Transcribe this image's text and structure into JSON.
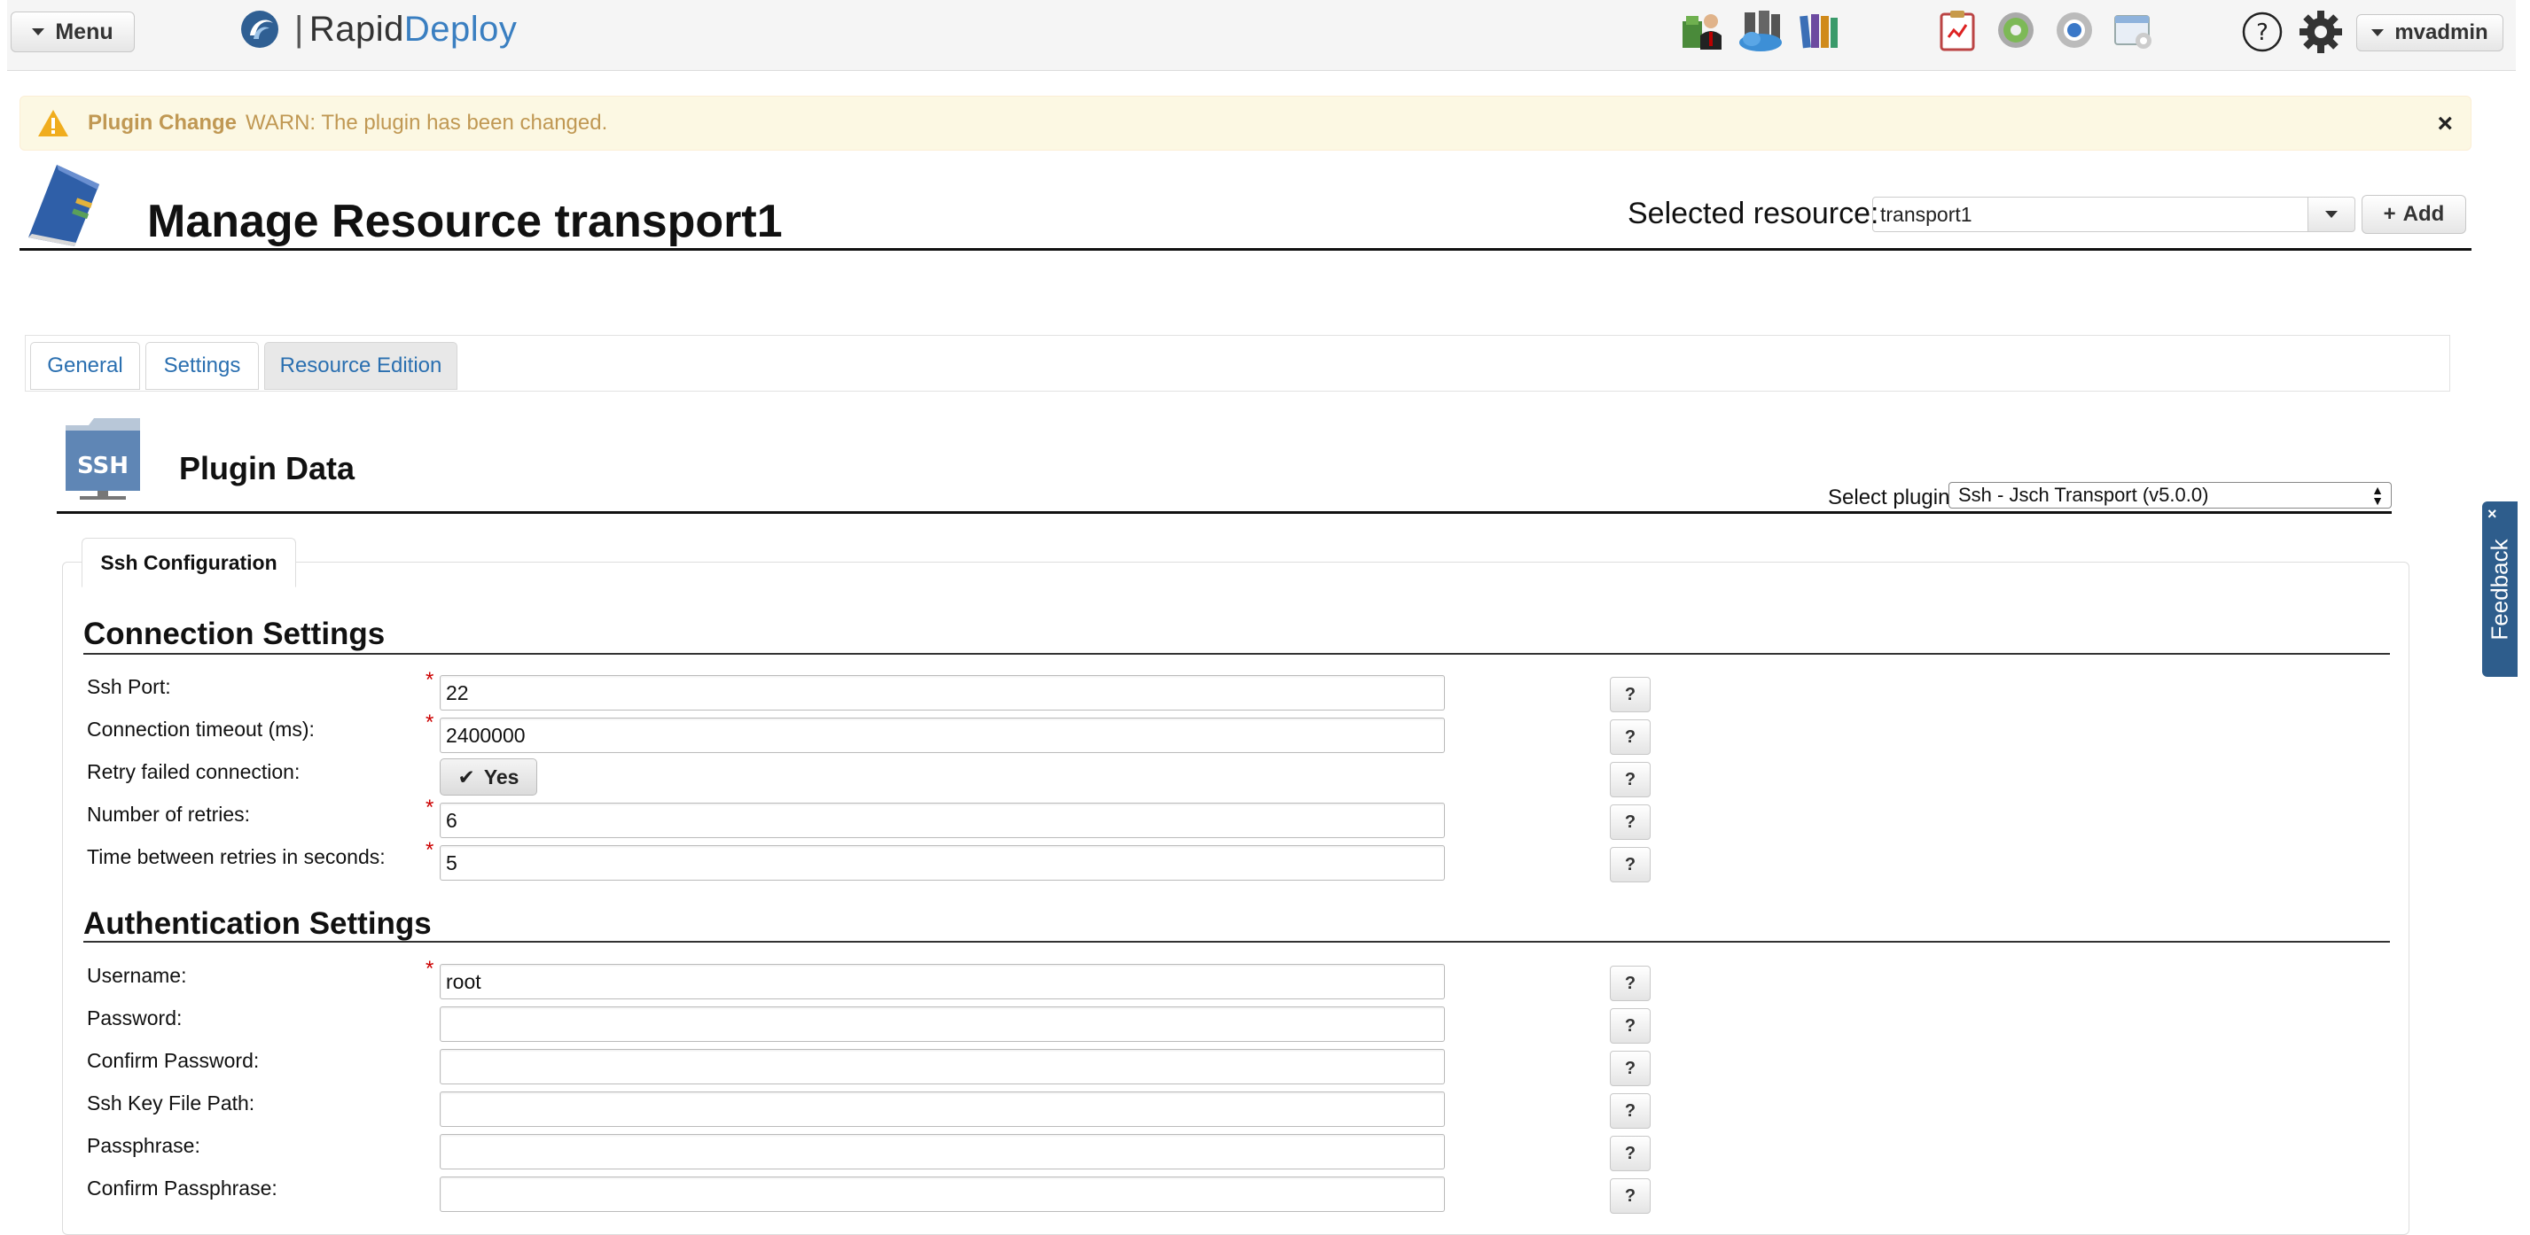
{
  "navbar": {
    "menu_label": "Menu",
    "brand_part1": "Rapid",
    "brand_part2": "Deploy",
    "user_label": "mvadmin"
  },
  "alert": {
    "title": "Plugin Change",
    "message": "WARN: The plugin has been changed.",
    "close": "×"
  },
  "header": {
    "title": "Manage Resource transport1",
    "selected_resource_label": "Selected resource:",
    "selected_resource_value": "transport1",
    "add_label": "Add"
  },
  "tabs": [
    {
      "label": "General"
    },
    {
      "label": "Settings"
    },
    {
      "label": "Resource Edition"
    }
  ],
  "plugin": {
    "title": "Plugin Data",
    "icon_text": "SSH",
    "select_label": "Select plugin",
    "select_value": "Ssh - Jsch Transport (v5.0.0)"
  },
  "config": {
    "tab_label": "Ssh Configuration",
    "connection_title": "Connection Settings",
    "auth_title": "Authentication Settings",
    "help_label": "?",
    "connection_fields": [
      {
        "label": "Ssh Port:",
        "value": "22"
      },
      {
        "label": "Connection timeout (ms):",
        "value": "2400000"
      },
      {
        "label": "Retry failed connection:",
        "value": "Yes"
      },
      {
        "label": "Number of retries:",
        "value": "6"
      },
      {
        "label": "Time between retries in seconds:",
        "value": "5"
      }
    ],
    "auth_fields": [
      {
        "label": "Username:",
        "value": "root"
      },
      {
        "label": "Password:",
        "value": ""
      },
      {
        "label": "Confirm Password:",
        "value": ""
      },
      {
        "label": "Ssh Key File Path:",
        "value": ""
      },
      {
        "label": "Passphrase:",
        "value": ""
      },
      {
        "label": "Confirm Passphrase:",
        "value": ""
      }
    ]
  },
  "feedback": {
    "label": "Feedback",
    "close": "×"
  }
}
